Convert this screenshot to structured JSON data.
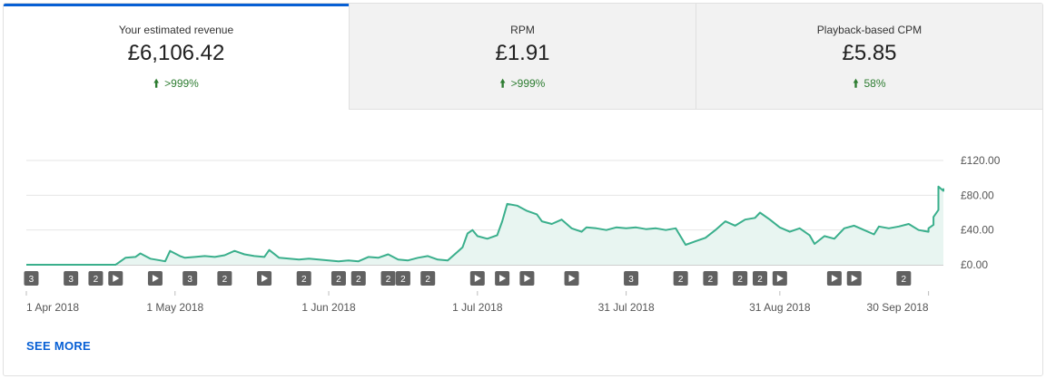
{
  "tabs": [
    {
      "label": "Your estimated revenue",
      "value": "£6,106.42",
      "change": ">999%",
      "active": true
    },
    {
      "label": "RPM",
      "value": "£1.91",
      "change": ">999%",
      "active": false
    },
    {
      "label": "Playback-based CPM",
      "value": "£5.85",
      "change": "58%",
      "active": false
    }
  ],
  "see_more": "SEE MORE",
  "colors": {
    "accent": "#065fd4",
    "positive": "#2e7d32",
    "line": "#3aaf8c",
    "fill": "#e8f5f1",
    "marker": "#616161"
  },
  "chart_data": {
    "type": "area",
    "ylim": [
      0,
      120
    ],
    "yticks": [
      {
        "value": 0,
        "label": "£0.00"
      },
      {
        "value": 40,
        "label": "£40.00"
      },
      {
        "value": 80,
        "label": "£80.00"
      },
      {
        "value": 120,
        "label": "£120.00"
      }
    ],
    "x_start": "2018-04-01",
    "x_end": "2018-10-03",
    "xticks": [
      {
        "date": "2018-04-01",
        "label": "1 Apr 2018"
      },
      {
        "date": "2018-05-01",
        "label": "1 May 2018"
      },
      {
        "date": "2018-06-01",
        "label": "1 Jun 2018"
      },
      {
        "date": "2018-07-01",
        "label": "1 Jul 2018"
      },
      {
        "date": "2018-07-31",
        "label": "31 Jul 2018"
      },
      {
        "date": "2018-08-31",
        "label": "31 Aug 2018"
      },
      {
        "date": "2018-09-30",
        "label": "30 Sep 2018"
      }
    ],
    "series": [
      {
        "points": [
          [
            "2018-04-01",
            0
          ],
          [
            "2018-04-05",
            0
          ],
          [
            "2018-04-10",
            0
          ],
          [
            "2018-04-15",
            0
          ],
          [
            "2018-04-19",
            0
          ],
          [
            "2018-04-21",
            8
          ],
          [
            "2018-04-23",
            9
          ],
          [
            "2018-04-24",
            13
          ],
          [
            "2018-04-26",
            7
          ],
          [
            "2018-04-28",
            5
          ],
          [
            "2018-04-29",
            4
          ],
          [
            "2018-04-30",
            16
          ],
          [
            "2018-05-02",
            10
          ],
          [
            "2018-05-03",
            8
          ],
          [
            "2018-05-05",
            9
          ],
          [
            "2018-05-07",
            10
          ],
          [
            "2018-05-09",
            9
          ],
          [
            "2018-05-11",
            11
          ],
          [
            "2018-05-13",
            16
          ],
          [
            "2018-05-15",
            12
          ],
          [
            "2018-05-17",
            10
          ],
          [
            "2018-05-19",
            9
          ],
          [
            "2018-05-20",
            17
          ],
          [
            "2018-05-22",
            8
          ],
          [
            "2018-05-24",
            7
          ],
          [
            "2018-05-26",
            6
          ],
          [
            "2018-05-28",
            7
          ],
          [
            "2018-05-30",
            6
          ],
          [
            "2018-06-01",
            5
          ],
          [
            "2018-06-03",
            4
          ],
          [
            "2018-06-05",
            5
          ],
          [
            "2018-06-07",
            4
          ],
          [
            "2018-06-09",
            9
          ],
          [
            "2018-06-11",
            8
          ],
          [
            "2018-06-13",
            12
          ],
          [
            "2018-06-15",
            6
          ],
          [
            "2018-06-17",
            5
          ],
          [
            "2018-06-19",
            8
          ],
          [
            "2018-06-21",
            10
          ],
          [
            "2018-06-23",
            6
          ],
          [
            "2018-06-25",
            5
          ],
          [
            "2018-06-27",
            15
          ],
          [
            "2018-06-28",
            20
          ],
          [
            "2018-06-29",
            36
          ],
          [
            "2018-06-30",
            40
          ],
          [
            "2018-07-01",
            33
          ],
          [
            "2018-07-03",
            30
          ],
          [
            "2018-07-05",
            34
          ],
          [
            "2018-07-06",
            50
          ],
          [
            "2018-07-07",
            70
          ],
          [
            "2018-07-09",
            68
          ],
          [
            "2018-07-11",
            62
          ],
          [
            "2018-07-13",
            58
          ],
          [
            "2018-07-14",
            50
          ],
          [
            "2018-07-16",
            47
          ],
          [
            "2018-07-18",
            52
          ],
          [
            "2018-07-20",
            42
          ],
          [
            "2018-07-22",
            38
          ],
          [
            "2018-07-23",
            43
          ],
          [
            "2018-07-25",
            42
          ],
          [
            "2018-07-27",
            40
          ],
          [
            "2018-07-29",
            43
          ],
          [
            "2018-07-31",
            42
          ],
          [
            "2018-08-02",
            43
          ],
          [
            "2018-08-04",
            41
          ],
          [
            "2018-08-06",
            42
          ],
          [
            "2018-08-08",
            40
          ],
          [
            "2018-08-10",
            42
          ],
          [
            "2018-08-12",
            23
          ],
          [
            "2018-08-14",
            27
          ],
          [
            "2018-08-16",
            31
          ],
          [
            "2018-08-18",
            40
          ],
          [
            "2018-08-20",
            50
          ],
          [
            "2018-08-22",
            45
          ],
          [
            "2018-08-24",
            52
          ],
          [
            "2018-08-26",
            54
          ],
          [
            "2018-08-27",
            60
          ],
          [
            "2018-08-29",
            52
          ],
          [
            "2018-08-31",
            43
          ],
          [
            "2018-09-02",
            38
          ],
          [
            "2018-09-04",
            42
          ],
          [
            "2018-09-06",
            34
          ],
          [
            "2018-09-07",
            24
          ],
          [
            "2018-09-09",
            33
          ],
          [
            "2018-09-11",
            30
          ],
          [
            "2018-09-13",
            42
          ],
          [
            "2018-09-15",
            45
          ],
          [
            "2018-09-17",
            40
          ],
          [
            "2018-09-19",
            35
          ],
          [
            "2018-09-20",
            44
          ],
          [
            "2018-09-22",
            42
          ],
          [
            "2018-09-24",
            44
          ],
          [
            "2018-09-26",
            47
          ],
          [
            "2018-09-28",
            40
          ],
          [
            "2018-09-30",
            38
          ],
          [
            "2018-09-30",
            40
          ],
          [
            "2018-09-30",
            42
          ],
          [
            "2018-10-01",
            46
          ],
          [
            "2018-10-01",
            55
          ],
          [
            "2018-10-02",
            63
          ],
          [
            "2018-10-02",
            90
          ],
          [
            "2018-10-03",
            85
          ],
          [
            "2018-10-03",
            88
          ]
        ]
      }
    ],
    "markers": [
      {
        "date": "2018-04-02",
        "label": "3"
      },
      {
        "date": "2018-04-10",
        "label": "3"
      },
      {
        "date": "2018-04-15",
        "label": "2"
      },
      {
        "date": "2018-04-19",
        "label": "play-icon"
      },
      {
        "date": "2018-04-27",
        "label": "play-icon"
      },
      {
        "date": "2018-05-04",
        "label": "3"
      },
      {
        "date": "2018-05-11",
        "label": "2"
      },
      {
        "date": "2018-05-19",
        "label": "play-icon"
      },
      {
        "date": "2018-05-27",
        "label": "2"
      },
      {
        "date": "2018-06-03",
        "label": "2"
      },
      {
        "date": "2018-06-07",
        "label": "2"
      },
      {
        "date": "2018-06-13",
        "label": "2"
      },
      {
        "date": "2018-06-16",
        "label": "2"
      },
      {
        "date": "2018-06-21",
        "label": "2"
      },
      {
        "date": "2018-07-01",
        "label": "play-icon"
      },
      {
        "date": "2018-07-06",
        "label": "play-icon"
      },
      {
        "date": "2018-07-11",
        "label": "play-icon"
      },
      {
        "date": "2018-07-20",
        "label": "play-icon"
      },
      {
        "date": "2018-08-01",
        "label": "3"
      },
      {
        "date": "2018-08-11",
        "label": "2"
      },
      {
        "date": "2018-08-17",
        "label": "2"
      },
      {
        "date": "2018-08-23",
        "label": "2"
      },
      {
        "date": "2018-08-27",
        "label": "2"
      },
      {
        "date": "2018-08-31",
        "label": "play-icon"
      },
      {
        "date": "2018-09-11",
        "label": "play-icon"
      },
      {
        "date": "2018-09-15",
        "label": "play-icon"
      },
      {
        "date": "2018-09-25",
        "label": "2"
      }
    ],
    "grid": true
  }
}
